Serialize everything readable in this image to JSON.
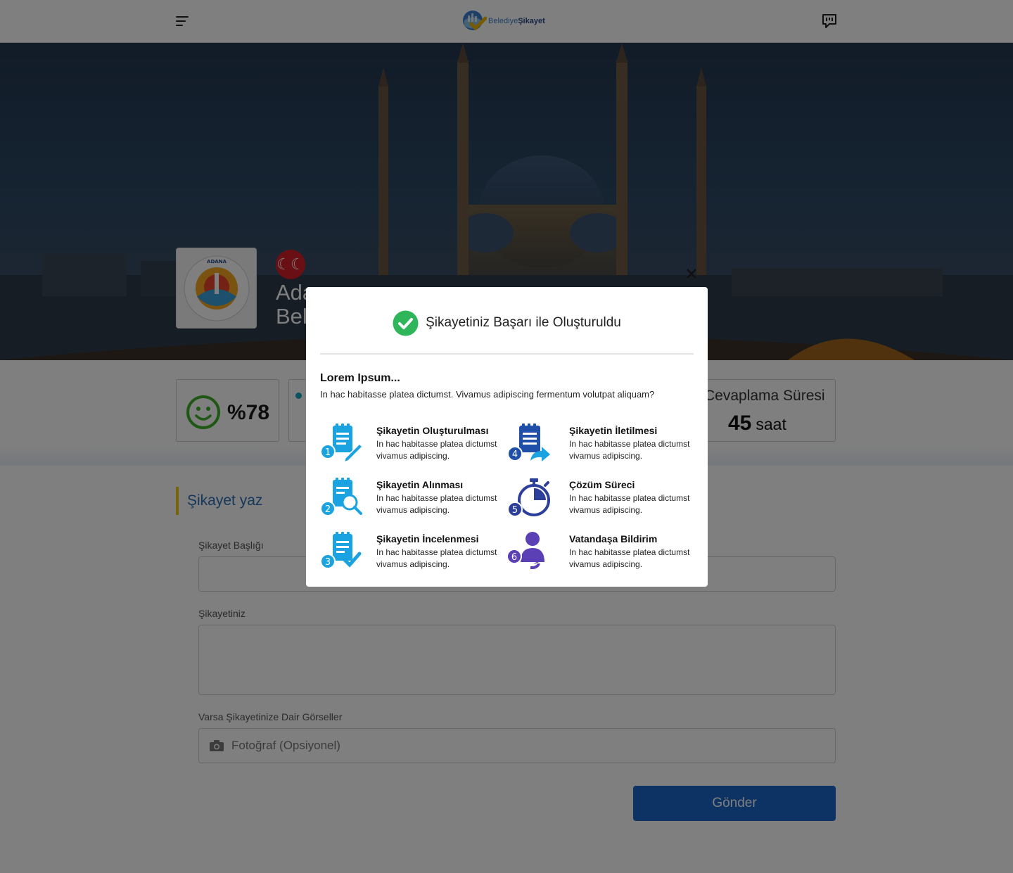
{
  "header": {
    "logo_text_light": "Belediye",
    "logo_text_bold": "Şikayet",
    "menu_icon": "hamburger-menu-icon",
    "chat_icon": "feedback-chat-icon"
  },
  "hero": {
    "municipality_logo_top": "ADANA",
    "municipality_logo_bottom": "BÜYÜKŞEHİR BELEDİYESİ",
    "municipality_name_line1": "Ada",
    "municipality_name_line2": "Bel"
  },
  "stats": {
    "satisfaction_value": "%78",
    "response_time_title": "Cevaplama Süresi",
    "response_time_value": "45",
    "response_time_unit": "saat"
  },
  "form": {
    "section_title": "Şikayet yaz",
    "title_label": "Şikayet Başlığı",
    "complaint_label": "Şikayetiniz",
    "images_label": "Varsa Şikayetinize Dair Görseller",
    "photo_placeholder": "Fotoğraf (Opsiyonel)",
    "submit_label": "Gönder"
  },
  "modal": {
    "title": "Şikayetiniz Başarı ile Oluşturuldu",
    "subtitle": "Lorem Ipsum...",
    "description": "In hac habitasse platea dictumst. Vivamus adipiscing fermentum volutpat aliquam?",
    "steps": [
      {
        "number": "1",
        "title": "Şikayetin Oluşturulması",
        "desc": "In hac habitasse platea dictumst vivamus adipiscing.",
        "icon": "clipboard-pencil-icon"
      },
      {
        "number": "2",
        "title": "Şikayetin Alınması",
        "desc": "In hac habitasse platea dictumst vivamus adipiscing.",
        "icon": "clipboard-search-icon"
      },
      {
        "number": "3",
        "title": "Şikayetin İncelenmesi",
        "desc": "In hac habitasse platea dictumst vivamus adipiscing.",
        "icon": "clipboard-check-icon"
      },
      {
        "number": "4",
        "title": "Şikayetin İletilmesi",
        "desc": "In hac habitasse platea dictumst vivamus adipiscing.",
        "icon": "clipboard-forward-icon"
      },
      {
        "number": "5",
        "title": "Çözüm Süreci",
        "desc": "In hac habitasse platea dictumst vivamus adipiscing.",
        "icon": "stopwatch-icon"
      },
      {
        "number": "6",
        "title": "Vatandaşa Bildirim",
        "desc": "In hac habitasse platea dictumst vivamus adipiscing.",
        "icon": "person-notify-icon"
      }
    ]
  },
  "colors": {
    "primary_blue": "#1a66c9",
    "accent_yellow": "#f0c419",
    "success_green": "#2fb65a",
    "step_cyan": "#1aa3e0",
    "step_navy": "#1f4fa8",
    "step_purple": "#5a3fb5"
  }
}
